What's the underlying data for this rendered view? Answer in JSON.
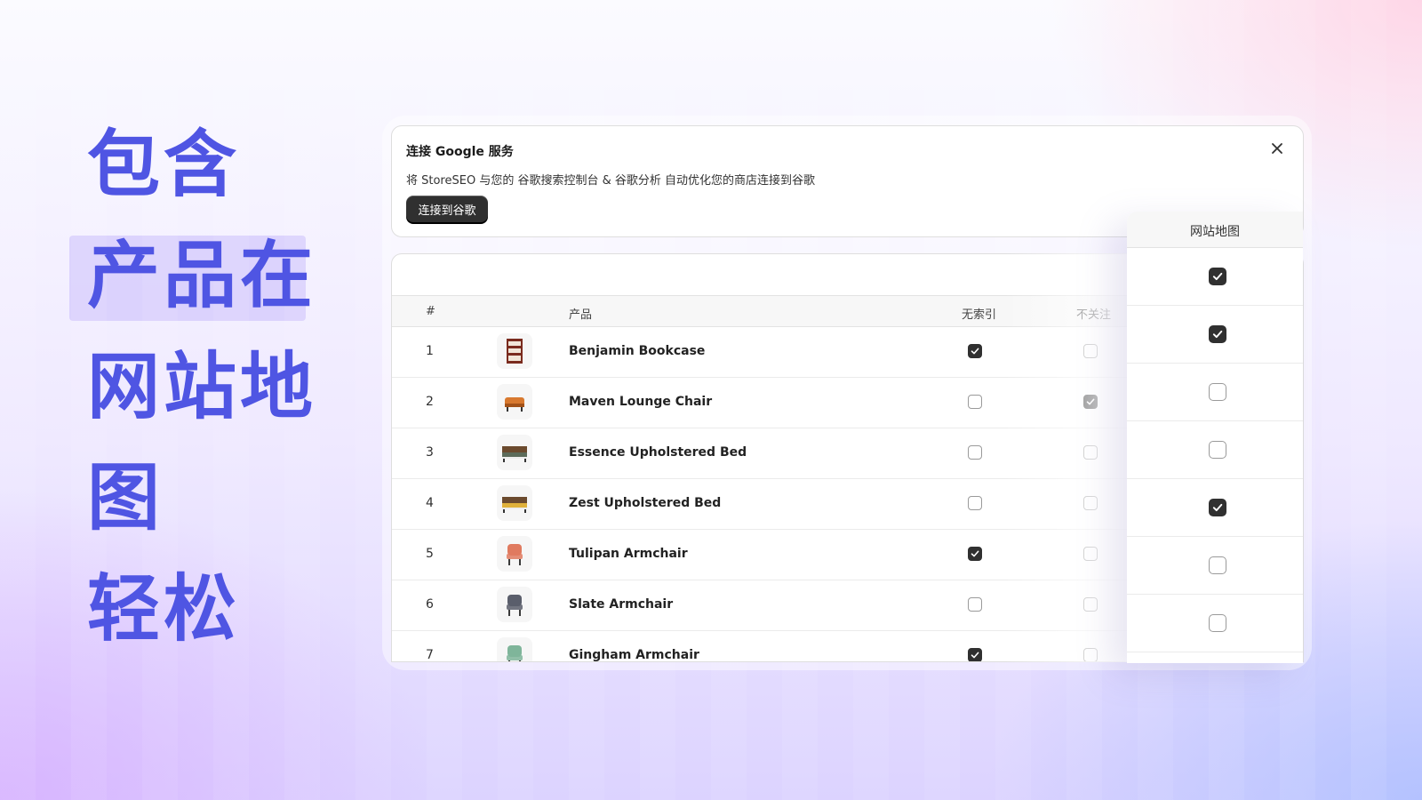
{
  "headline": {
    "lines": [
      "包含",
      "产品在",
      "网站地",
      "图",
      "轻松"
    ]
  },
  "google_panel": {
    "title": "连接 Google 服务",
    "description": "将 StoreSEO 与您的 谷歌搜索控制台 & 谷歌分析 自动优化您的商店连接到谷歌",
    "button_label": "连接到谷歌",
    "close_icon": "close-icon"
  },
  "table": {
    "headers": {
      "index": "#",
      "product": "产品",
      "noindex": "无索引",
      "nofollow": "不关注"
    },
    "rows": [
      {
        "index": "1",
        "name": "Benjamin Bookcase",
        "image_icon": "bookcase-icon",
        "noindex": true,
        "nofollow": false
      },
      {
        "index": "2",
        "name": "Maven Lounge Chair",
        "image_icon": "lounge-chair-icon",
        "noindex": false,
        "nofollow": true
      },
      {
        "index": "3",
        "name": "Essence Upholstered Bed",
        "image_icon": "bed-icon",
        "noindex": false,
        "nofollow": false
      },
      {
        "index": "4",
        "name": "Zest Upholstered Bed",
        "image_icon": "bed-icon",
        "noindex": false,
        "nofollow": false
      },
      {
        "index": "5",
        "name": "Tulipan Armchair",
        "image_icon": "armchair-icon",
        "noindex": true,
        "nofollow": false
      },
      {
        "index": "6",
        "name": "Slate Armchair",
        "image_icon": "armchair-icon",
        "noindex": false,
        "nofollow": false
      },
      {
        "index": "7",
        "name": "Gingham Armchair",
        "image_icon": "armchair-icon",
        "noindex": true,
        "nofollow": false
      }
    ]
  },
  "sitemap_panel": {
    "header": "网站地图",
    "values": [
      true,
      true,
      false,
      false,
      true,
      false,
      false
    ]
  },
  "colors": {
    "headline": "#4f55e3",
    "checkbox_checked": "#303030",
    "button_bg": "#303030"
  }
}
